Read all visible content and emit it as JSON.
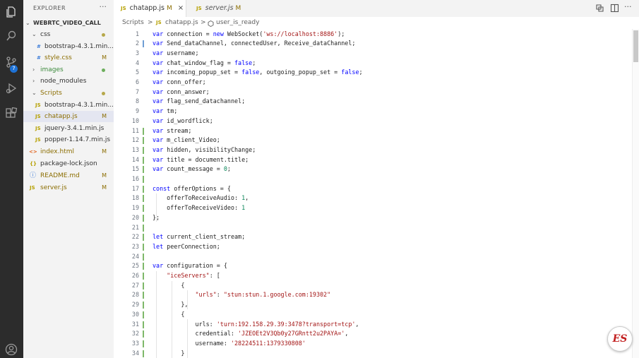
{
  "activity_bar": {
    "icons": [
      "files-icon",
      "search-icon",
      "source-control-icon",
      "run-debug-icon",
      "extensions-icon",
      "account-icon"
    ],
    "scm_badge": "7"
  },
  "sidebar": {
    "title": "EXPLORER",
    "more": "···",
    "project": "WEBRTC_VIDEO_CALL",
    "items": [
      {
        "label": "css",
        "type": "folder",
        "status": "dot"
      },
      {
        "label": "bootstrap-4.3.1.min....",
        "type": "css",
        "status": "",
        "prefix": "#"
      },
      {
        "label": "style.css",
        "type": "css",
        "status": "M",
        "prefix": "#"
      },
      {
        "label": "images",
        "type": "folder-collapsed",
        "status": "dot"
      },
      {
        "label": "node_modules",
        "type": "folder-collapsed",
        "status": ""
      },
      {
        "label": "Scripts",
        "type": "folder",
        "status": "dot"
      },
      {
        "label": "bootstrap-4.3.1.min....",
        "type": "js",
        "status": "",
        "prefix": "JS"
      },
      {
        "label": "chatapp.js",
        "type": "js",
        "status": "M",
        "prefix": "JS"
      },
      {
        "label": "jquery-3.4.1.min.js",
        "type": "js",
        "status": "",
        "prefix": "JS"
      },
      {
        "label": "popper-1.14.7.min.js",
        "type": "js",
        "status": "",
        "prefix": "JS"
      },
      {
        "label": "index.html",
        "type": "html",
        "status": "M",
        "prefix": "<>"
      },
      {
        "label": "package-lock.json",
        "type": "json",
        "status": "",
        "prefix": "{}"
      },
      {
        "label": "README.md",
        "type": "info",
        "status": "M",
        "prefix": "ⓘ"
      },
      {
        "label": "server.js",
        "type": "js",
        "status": "M",
        "prefix": "JS"
      }
    ]
  },
  "tabs": [
    {
      "label": "chatapp.js",
      "prefix": "JS",
      "modified": "M",
      "close": "×"
    },
    {
      "label": "server.js",
      "prefix": "JS",
      "modified": "M"
    }
  ],
  "breadcrumb": {
    "folder": "Scripts",
    "sep1": ">",
    "file_prefix": "JS",
    "file": "chatapp.js",
    "sep2": ">",
    "symbol": "user_is_ready"
  },
  "code_lines": [
    {
      "n": "1",
      "g": "",
      "t": "var connection = new WebSocket('ws://localhost:8886');"
    },
    {
      "n": "2",
      "g": "mod",
      "t": "var Send_dataChannel, connectedUser, Receive_dataChannel;"
    },
    {
      "n": "3",
      "g": "",
      "t": "var username;"
    },
    {
      "n": "4",
      "g": "",
      "t": "var chat_window_flag = false;"
    },
    {
      "n": "5",
      "g": "",
      "t": "var incoming_popup_set = false, outgoing_popup_set = false;"
    },
    {
      "n": "6",
      "g": "",
      "t": "var conn_offer;"
    },
    {
      "n": "7",
      "g": "",
      "t": "var conn_answer;"
    },
    {
      "n": "8",
      "g": "",
      "t": "var flag_send_datachannel;"
    },
    {
      "n": "9",
      "g": "",
      "t": "var tm;"
    },
    {
      "n": "10",
      "g": "",
      "t": "var id_wordflick;"
    },
    {
      "n": "11",
      "g": "add",
      "t": "var stream;"
    },
    {
      "n": "12",
      "g": "add",
      "t": "var m_client_Video;"
    },
    {
      "n": "13",
      "g": "add",
      "t": "var hidden, visibilityChange;"
    },
    {
      "n": "14",
      "g": "add",
      "t": "var title = document.title;"
    },
    {
      "n": "15",
      "g": "add",
      "t": "var count_message = 0;"
    },
    {
      "n": "16",
      "g": "add",
      "t": ""
    },
    {
      "n": "17",
      "g": "add",
      "t": "const offerOptions = {"
    },
    {
      "n": "18",
      "g": "add",
      "t": "    offerToReceiveAudio: 1,"
    },
    {
      "n": "19",
      "g": "add",
      "t": "    offerToReceiveVideo: 1"
    },
    {
      "n": "20",
      "g": "add",
      "t": "};"
    },
    {
      "n": "21",
      "g": "add",
      "t": ""
    },
    {
      "n": "22",
      "g": "add",
      "t": "let current_client_stream;"
    },
    {
      "n": "23",
      "g": "add",
      "t": "let peerConnection;"
    },
    {
      "n": "24",
      "g": "add",
      "t": ""
    },
    {
      "n": "25",
      "g": "add",
      "t": "var configuration = {"
    },
    {
      "n": "26",
      "g": "add",
      "t": "    \"iceServers\": ["
    },
    {
      "n": "27",
      "g": "add",
      "t": "        {"
    },
    {
      "n": "28",
      "g": "add",
      "t": "            \"urls\": \"stun:stun.1.google.com:19302\""
    },
    {
      "n": "29",
      "g": "add",
      "t": "        },"
    },
    {
      "n": "30",
      "g": "add",
      "t": "        {"
    },
    {
      "n": "31",
      "g": "add",
      "t": "            urls: 'turn:192.158.29.39:3478?transport=tcp',"
    },
    {
      "n": "32",
      "g": "add",
      "t": "            credential: 'JZEOEt2V3Qb0y27GRntt2u2PAYA=',"
    },
    {
      "n": "33",
      "g": "add",
      "t": "            username: '28224511:1379330808'"
    },
    {
      "n": "34",
      "g": "add",
      "t": "        }"
    }
  ],
  "logo_text": "ES",
  "colors": {
    "keyword": "#0000ff",
    "string": "#a31515",
    "number": "#098658",
    "modified": "#8b6d00",
    "activity_bar": "#2c2c2c",
    "badge": "#1e72d6"
  }
}
